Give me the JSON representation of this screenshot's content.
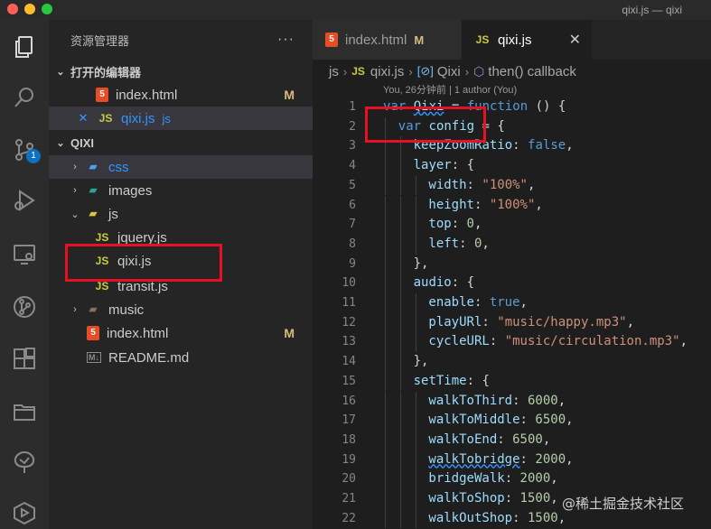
{
  "window": {
    "title": "qixi.js — qixi"
  },
  "activity_bar": {
    "items": [
      "explorer",
      "search",
      "source-control",
      "run-and-debug",
      "remote-explorer",
      "git-graph",
      "extensions",
      "folders",
      "tree",
      "live-share"
    ],
    "scm_badge": "1"
  },
  "sidebar": {
    "title": "资源管理器",
    "more": "···",
    "open_editors_label": "打开的编辑器",
    "open_editors": [
      {
        "name": "index.html",
        "status": "M"
      },
      {
        "name": "qixi.js",
        "desc": "js"
      }
    ],
    "project_label": "QIXI",
    "tree": [
      {
        "name": "css"
      },
      {
        "name": "images"
      },
      {
        "name": "js"
      },
      {
        "name": "jquery.js"
      },
      {
        "name": "qixi.js"
      },
      {
        "name": "transit.js"
      },
      {
        "name": "music"
      },
      {
        "name": "index.html",
        "status": "M"
      },
      {
        "name": "README.md"
      }
    ]
  },
  "tabs": [
    {
      "label": "index.html",
      "status": "M"
    },
    {
      "label": "qixi.js",
      "close": "✕"
    }
  ],
  "breadcrumb": [
    "js",
    "qixi.js",
    "Qixi",
    "then() callback"
  ],
  "blame": "You, 26分钟前 | 1 author (You)",
  "editor": {
    "lines": [
      {
        "n": "1",
        "indent": 0,
        "tokens": [
          [
            "kw",
            "var "
          ],
          [
            "prop squig",
            "Qixi"
          ],
          [
            "pun",
            " = "
          ],
          [
            "kw",
            "function"
          ],
          [
            "pun",
            " () {"
          ]
        ]
      },
      {
        "n": "2",
        "indent": 1,
        "tokens": [
          [
            "kw",
            "var "
          ],
          [
            "prop",
            "config"
          ],
          [
            "pun",
            " = {"
          ]
        ]
      },
      {
        "n": "3",
        "indent": 2,
        "tokens": [
          [
            "prop",
            "keepZoomRatio"
          ],
          [
            "pun",
            ": "
          ],
          [
            "kw",
            "false"
          ],
          [
            "pun",
            ","
          ]
        ]
      },
      {
        "n": "4",
        "indent": 2,
        "tokens": [
          [
            "prop",
            "layer"
          ],
          [
            "pun",
            ": {"
          ]
        ]
      },
      {
        "n": "5",
        "indent": 3,
        "tokens": [
          [
            "prop",
            "width"
          ],
          [
            "pun",
            ": "
          ],
          [
            "str",
            "\"100%\""
          ],
          [
            "pun",
            ","
          ]
        ]
      },
      {
        "n": "6",
        "indent": 3,
        "tokens": [
          [
            "prop",
            "height"
          ],
          [
            "pun",
            ": "
          ],
          [
            "str",
            "\"100%\""
          ],
          [
            "pun",
            ","
          ]
        ]
      },
      {
        "n": "7",
        "indent": 3,
        "tokens": [
          [
            "prop",
            "top"
          ],
          [
            "pun",
            ": "
          ],
          [
            "num",
            "0"
          ],
          [
            "pun",
            ","
          ]
        ]
      },
      {
        "n": "8",
        "indent": 3,
        "tokens": [
          [
            "prop",
            "left"
          ],
          [
            "pun",
            ": "
          ],
          [
            "num",
            "0"
          ],
          [
            "pun",
            ","
          ]
        ]
      },
      {
        "n": "9",
        "indent": 2,
        "tokens": [
          [
            "pun",
            "},"
          ]
        ]
      },
      {
        "n": "10",
        "indent": 2,
        "tokens": [
          [
            "prop",
            "audio"
          ],
          [
            "pun",
            ": {"
          ]
        ]
      },
      {
        "n": "11",
        "indent": 3,
        "tokens": [
          [
            "prop",
            "enable"
          ],
          [
            "pun",
            ": "
          ],
          [
            "kw",
            "true"
          ],
          [
            "pun",
            ","
          ]
        ]
      },
      {
        "n": "12",
        "indent": 3,
        "tokens": [
          [
            "prop",
            "playURl"
          ],
          [
            "pun",
            ": "
          ],
          [
            "str",
            "\"music/happy.mp3\""
          ],
          [
            "pun",
            ","
          ]
        ]
      },
      {
        "n": "13",
        "indent": 3,
        "tokens": [
          [
            "prop",
            "cycleURL"
          ],
          [
            "pun",
            ": "
          ],
          [
            "str",
            "\"music/circulation.mp3\""
          ],
          [
            "pun",
            ","
          ]
        ]
      },
      {
        "n": "14",
        "indent": 2,
        "tokens": [
          [
            "pun",
            "},"
          ]
        ]
      },
      {
        "n": "15",
        "indent": 2,
        "tokens": [
          [
            "prop",
            "setTime"
          ],
          [
            "pun",
            ": {"
          ]
        ]
      },
      {
        "n": "16",
        "indent": 3,
        "tokens": [
          [
            "prop",
            "walkToThird"
          ],
          [
            "pun",
            ": "
          ],
          [
            "num",
            "6000"
          ],
          [
            "pun",
            ","
          ]
        ]
      },
      {
        "n": "17",
        "indent": 3,
        "tokens": [
          [
            "prop",
            "walkToMiddle"
          ],
          [
            "pun",
            ": "
          ],
          [
            "num",
            "6500"
          ],
          [
            "pun",
            ","
          ]
        ]
      },
      {
        "n": "18",
        "indent": 3,
        "tokens": [
          [
            "prop",
            "walkToEnd"
          ],
          [
            "pun",
            ": "
          ],
          [
            "num",
            "6500"
          ],
          [
            "pun",
            ","
          ]
        ]
      },
      {
        "n": "19",
        "indent": 3,
        "tokens": [
          [
            "prop squig",
            "walkTobridge"
          ],
          [
            "pun",
            ": "
          ],
          [
            "num",
            "2000"
          ],
          [
            "pun",
            ","
          ]
        ]
      },
      {
        "n": "20",
        "indent": 3,
        "tokens": [
          [
            "prop",
            "bridgeWalk"
          ],
          [
            "pun",
            ": "
          ],
          [
            "num",
            "2000"
          ],
          [
            "pun",
            ","
          ]
        ]
      },
      {
        "n": "21",
        "indent": 3,
        "tokens": [
          [
            "prop",
            "walkToShop"
          ],
          [
            "pun",
            ": "
          ],
          [
            "num",
            "1500"
          ],
          [
            "pun",
            ","
          ]
        ]
      },
      {
        "n": "22",
        "indent": 3,
        "tokens": [
          [
            "prop",
            "walkOutShop"
          ],
          [
            "pun",
            ": "
          ],
          [
            "num",
            "1500"
          ],
          [
            "pun",
            ","
          ]
        ]
      }
    ]
  },
  "watermark": "@稀土掘金技术社区"
}
